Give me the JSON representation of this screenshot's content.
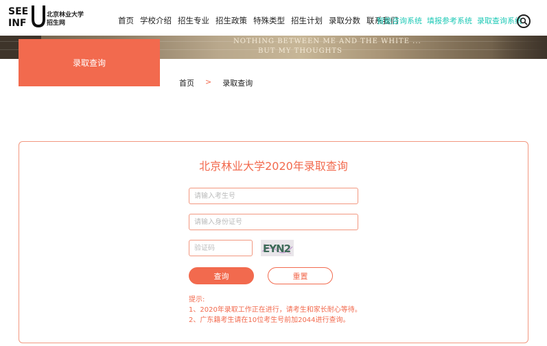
{
  "header": {
    "logo_text": "SEE INFU",
    "site_name_line1": "北京林业大学",
    "site_name_line2": "招生网",
    "nav": [
      "首页",
      "学校介绍",
      "招生专业",
      "招生政策",
      "特殊类型",
      "招生计划",
      "录取分数",
      "联系我们"
    ],
    "systems": [
      "智能咨询系统",
      "填报参考系统",
      "录取查询系统"
    ],
    "search_icon": "search-icon"
  },
  "banner": {
    "quote_line1": "NOTHING BETWEEN ME AND THE WHITE ...",
    "quote_line2": "BUT MY THOUGHTS"
  },
  "section_tab": "录取查询",
  "breadcrumb": {
    "home": "首页",
    "separator": ">",
    "current": "录取查询"
  },
  "query": {
    "title": "北京林业大学2020年录取查询",
    "exam_no_placeholder": "请输入考生号",
    "id_no_placeholder": "请输入身份证号",
    "captcha_placeholder": "验证码",
    "captcha_text": "EYN2",
    "query_button": "查询",
    "reset_button": "重置",
    "tips_title": "提示:",
    "tips": [
      "1、2020年录取工作正在进行，请考生和家长耐心等待。",
      "2、广东籍考生请在10位考生号前加2044进行查询。"
    ]
  },
  "colors": {
    "accent": "#f26a4e",
    "system_links": "#1ec9b6"
  }
}
